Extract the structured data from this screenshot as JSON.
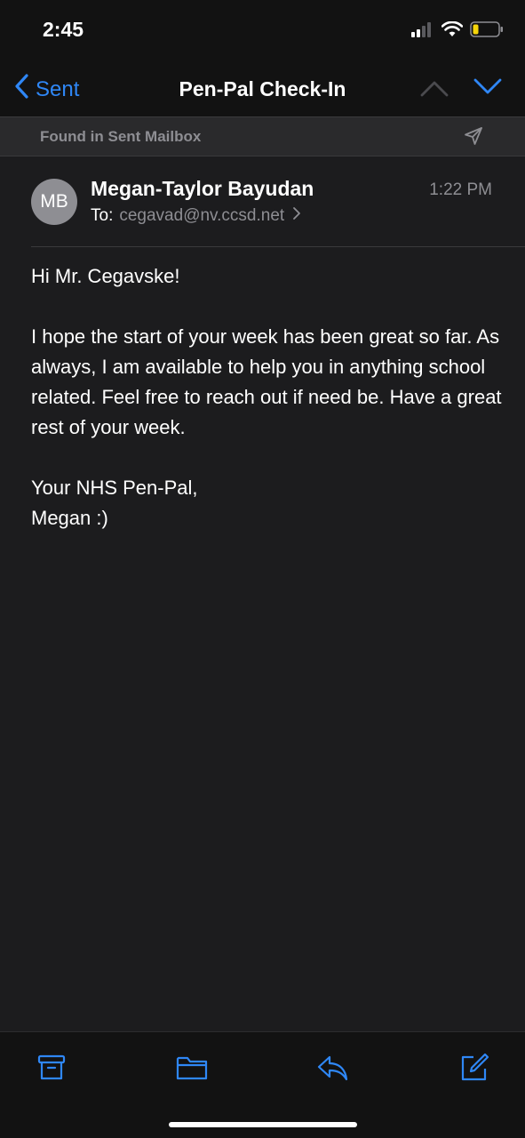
{
  "status_bar": {
    "time": "2:45",
    "icons": [
      "cellular-signal-icon",
      "wifi-icon",
      "battery-low-icon"
    ]
  },
  "nav": {
    "back_label": "Sent",
    "title": "Pen-Pal Check-In",
    "icons": [
      "chevron-left-icon",
      "chevron-up-icon",
      "chevron-down-icon"
    ]
  },
  "banner": {
    "text": "Found in Sent Mailbox",
    "icon": "paper-plane-icon"
  },
  "message": {
    "avatar_initials": "MB",
    "sender": "Megan-Taylor Bayudan",
    "time": "1:22 PM",
    "to_label": "To:",
    "to_address": "cegavad@nv.ccsd.net",
    "paragraphs": [
      "Hi Mr. Cegavske!",
      "I hope the start of your week has been great so far. As always, I am available to help you in anything school related. Feel free to reach out if need be. Have a great rest of your week.",
      "Your NHS Pen-Pal,\nMegan :)"
    ]
  },
  "toolbar": {
    "icons": [
      "archive-icon",
      "folder-icon",
      "reply-icon",
      "compose-icon"
    ]
  },
  "colors": {
    "accent": "#2f87f6",
    "background": "#1c1c1e",
    "secondary_text": "#8e8e93",
    "battery_low": "#f5d50a"
  }
}
